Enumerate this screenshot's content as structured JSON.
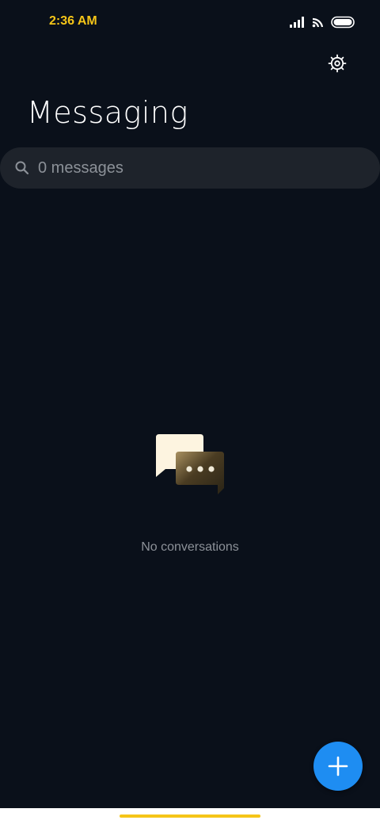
{
  "status_bar": {
    "time": "2:36 AM",
    "icons": [
      "signal-icon",
      "wifi-icon",
      "battery-icon"
    ],
    "time_color": "#f5c518"
  },
  "header": {
    "title": "Messaging",
    "settings_icon": "gear-icon"
  },
  "search": {
    "placeholder": "0 messages",
    "icon": "search-icon"
  },
  "empty_state": {
    "icon": "chat-bubbles-icon",
    "message": "No conversations"
  },
  "fab": {
    "icon": "plus-icon",
    "color": "#1e8df2"
  },
  "theme": {
    "background": "#0a101a",
    "search_background": "#1e232b",
    "accent": "#1e8df2",
    "home_indicator": "#f5c518"
  }
}
